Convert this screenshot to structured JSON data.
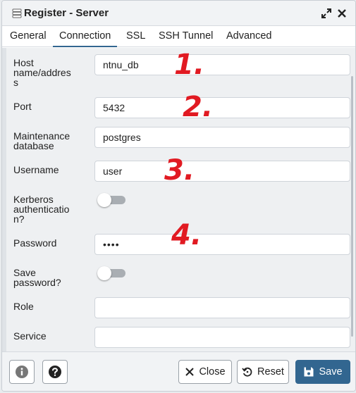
{
  "window": {
    "title": "Register - Server"
  },
  "tabs": [
    {
      "label": "General"
    },
    {
      "label": "Connection",
      "active": true
    },
    {
      "label": "SSL"
    },
    {
      "label": "SSH Tunnel"
    },
    {
      "label": "Advanced"
    }
  ],
  "form": {
    "host": {
      "label_lines": [
        "Host",
        "name/addres",
        "s"
      ],
      "value": "ntnu_db"
    },
    "port": {
      "label": "Port",
      "value": "5432"
    },
    "maintenance_db": {
      "label_lines": [
        "Maintenance",
        "database"
      ],
      "value": "postgres"
    },
    "username": {
      "label": "Username",
      "value": "user"
    },
    "kerberos": {
      "label_lines": [
        "Kerberos",
        "authenticatio",
        "n?"
      ],
      "enabled": false
    },
    "password": {
      "label": "Password",
      "value": "••••"
    },
    "save_password": {
      "label_lines": [
        "Save",
        "password?"
      ],
      "enabled": false
    },
    "role": {
      "label": "Role",
      "value": ""
    },
    "service": {
      "label": "Service",
      "value": ""
    }
  },
  "annotations": [
    "1.",
    "2.",
    "3.",
    "4."
  ],
  "footer": {
    "info_icon": "info-icon",
    "help_icon": "help-icon",
    "close_label": "Close",
    "reset_label": "Reset",
    "save_label": "Save"
  },
  "colors": {
    "primary": "#326690",
    "annotation": "#e11a22"
  }
}
